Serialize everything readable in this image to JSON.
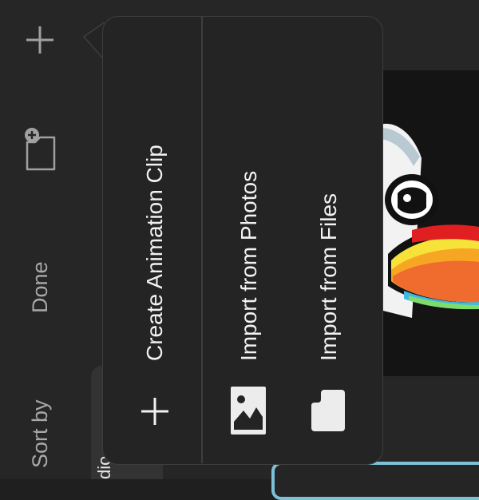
{
  "sidebar": {
    "add_icon": "plus-icon",
    "new_folder_icon": "folder-plus-icon",
    "done_label": "Done",
    "sort_label": "Sort by"
  },
  "panel": {
    "label_fragment": "dio"
  },
  "menu": {
    "items": [
      {
        "label": "Create Animation Clip",
        "icon": "plus-icon"
      },
      {
        "label": "Import from Photos",
        "icon": "photo-icon"
      },
      {
        "label": "Import from Files",
        "icon": "file-icon"
      }
    ]
  }
}
